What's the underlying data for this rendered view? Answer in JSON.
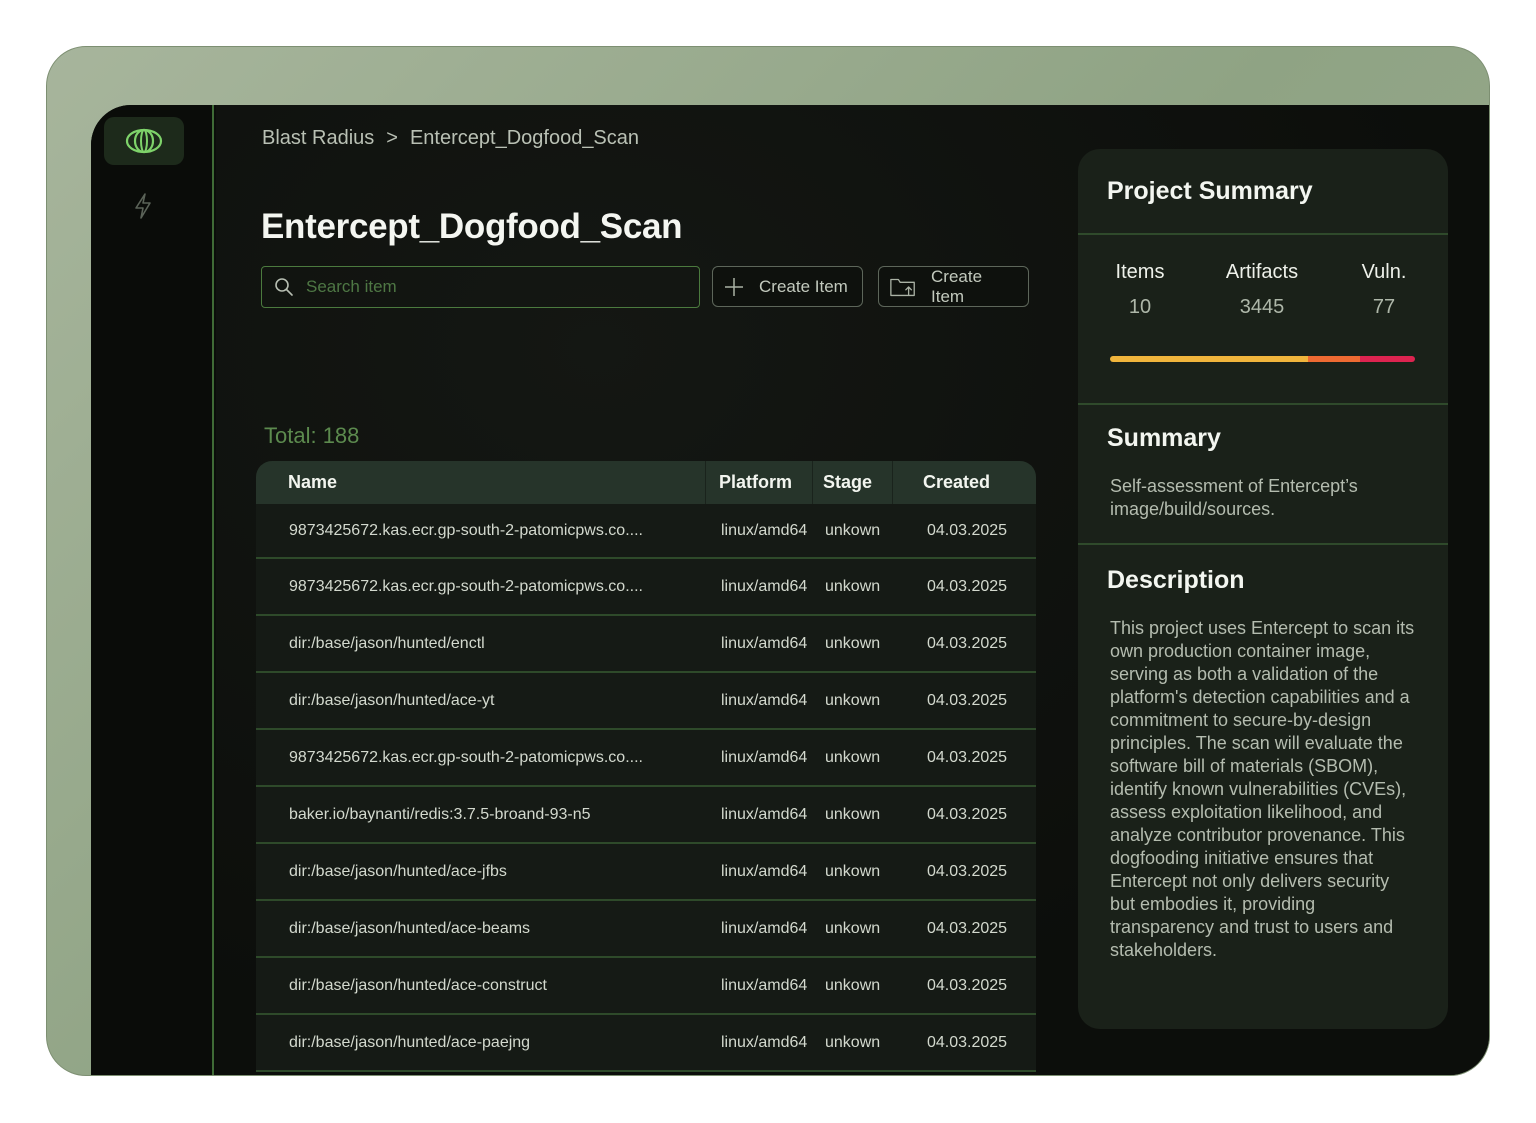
{
  "breadcrumb": {
    "root": "Blast Radius",
    "separator": ">",
    "current": "Entercept_Dogfood_Scan"
  },
  "page": {
    "title": "Entercept_Dogfood_Scan"
  },
  "toolbar": {
    "search_placeholder": "Search item",
    "create_label": "Create Item",
    "folder_label": "Create Item"
  },
  "total_label": "Total: 188",
  "table": {
    "headers": [
      "Name",
      "Platform",
      "Stage",
      "Created"
    ],
    "rows": [
      {
        "name": "9873425672.kas.ecr.gp-south-2-patomicpws.co....",
        "platform": "linux/amd64",
        "stage": "unkown",
        "created": "04.03.2025"
      },
      {
        "name": "9873425672.kas.ecr.gp-south-2-patomicpws.co....",
        "platform": "linux/amd64",
        "stage": "unkown",
        "created": "04.03.2025"
      },
      {
        "name": "dir:/base/jason/hunted/enctl",
        "platform": "linux/amd64",
        "stage": "unkown",
        "created": "04.03.2025"
      },
      {
        "name": "dir:/base/jason/hunted/ace-yt",
        "platform": "linux/amd64",
        "stage": "unkown",
        "created": "04.03.2025"
      },
      {
        "name": "9873425672.kas.ecr.gp-south-2-patomicpws.co....",
        "platform": "linux/amd64",
        "stage": "unkown",
        "created": "04.03.2025"
      },
      {
        "name": "baker.io/baynanti/redis:3.7.5-broand-93-n5",
        "platform": "linux/amd64",
        "stage": "unkown",
        "created": "04.03.2025"
      },
      {
        "name": "dir:/base/jason/hunted/ace-jfbs",
        "platform": "linux/amd64",
        "stage": "unkown",
        "created": "04.03.2025"
      },
      {
        "name": "dir:/base/jason/hunted/ace-beams",
        "platform": "linux/amd64",
        "stage": "unkown",
        "created": "04.03.2025"
      },
      {
        "name": "dir:/base/jason/hunted/ace-construct",
        "platform": "linux/amd64",
        "stage": "unkown",
        "created": "04.03.2025"
      },
      {
        "name": "dir:/base/jason/hunted/ace-paejng",
        "platform": "linux/amd64",
        "stage": "unkown",
        "created": "04.03.2025"
      }
    ]
  },
  "project_summary": {
    "title": "Project Summary",
    "stats": [
      {
        "label": "Items",
        "value": "10"
      },
      {
        "label": "Artifacts",
        "value": "3445"
      },
      {
        "label": "Vuln.",
        "value": "77"
      }
    ],
    "severity": [
      {
        "fraction": 0.65,
        "color": "#f0b53c"
      },
      {
        "fraction": 0.17,
        "color": "#ee6a32"
      },
      {
        "fraction": 0.18,
        "color": "#dd2450"
      }
    ],
    "summary_title": "Summary",
    "summary_text": "Self-assessment of Entercept’s image/build/sources.",
    "description_title": "Description",
    "description_text": "This project uses Entercept to scan its own production container image, serving as both a validation of the platform's detection capabilities and a commitment to secure-by-design principles. The scan will evaluate the software bill of materials (SBOM), identify known vulnerabilities (CVEs), assess exploitation likelihood, and analyze contributor provenance. This dogfooding initiative ensures that Entercept not only delivers security but embodies it, providing transparency and trust to users and stakeholders."
  },
  "icons": {
    "logo": "orbit-logo-icon",
    "rail_item": "lightning-icon",
    "search": "search-icon",
    "create": "plus-icon",
    "folder": "folder-upload-icon"
  }
}
